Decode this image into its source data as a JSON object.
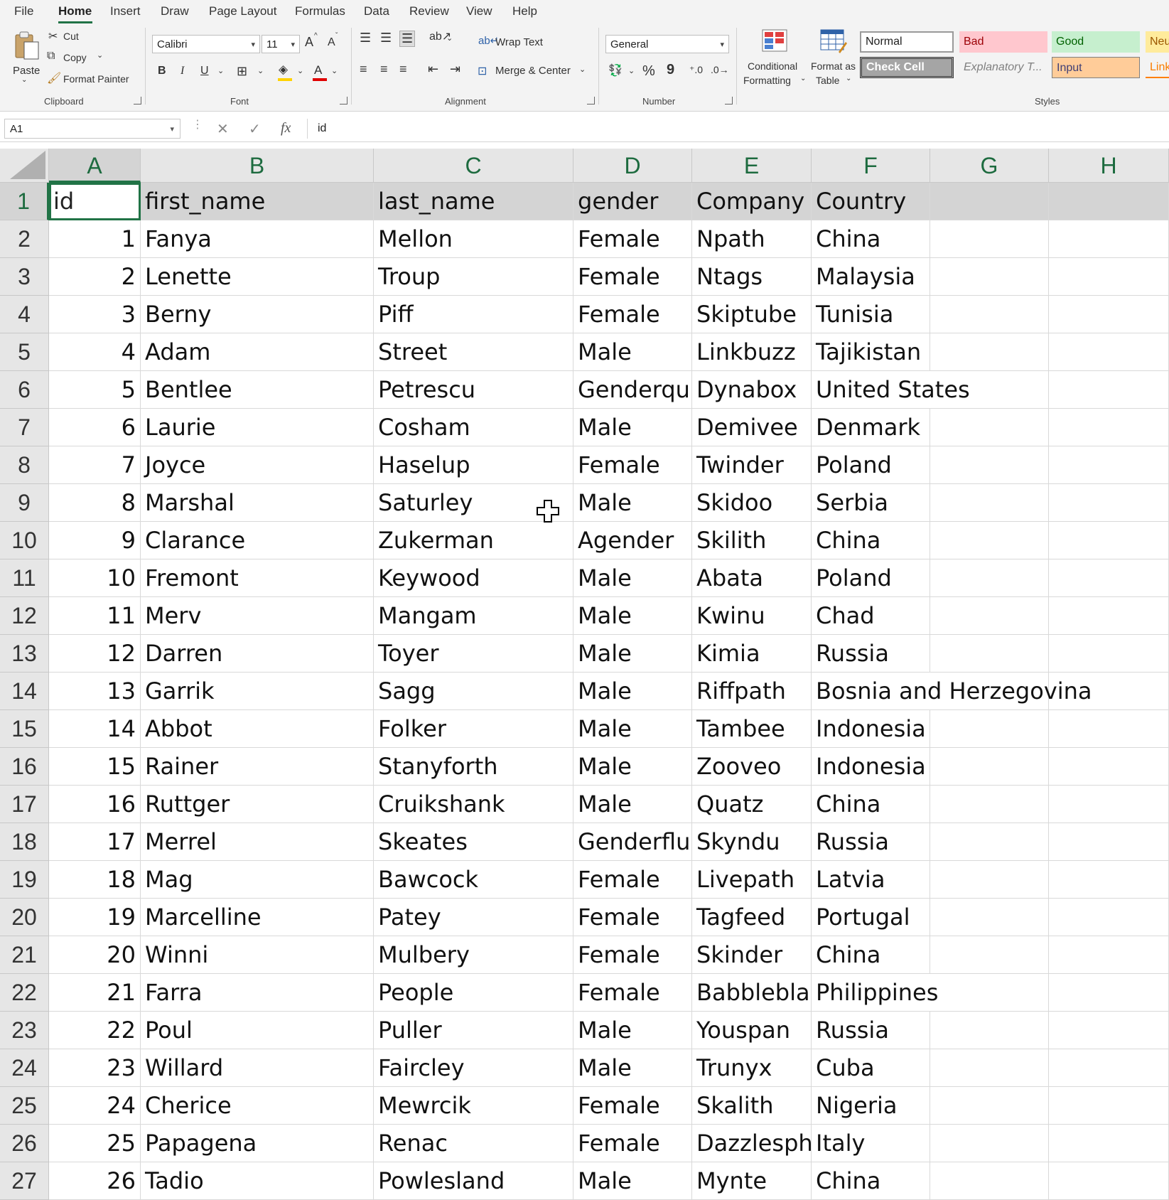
{
  "menu": {
    "tabs": [
      {
        "label": "File"
      },
      {
        "label": "Home",
        "active": true
      },
      {
        "label": "Insert"
      },
      {
        "label": "Draw"
      },
      {
        "label": "Page Layout"
      },
      {
        "label": "Formulas"
      },
      {
        "label": "Data"
      },
      {
        "label": "Review"
      },
      {
        "label": "View"
      },
      {
        "label": "Help"
      }
    ]
  },
  "ribbon": {
    "clipboard": {
      "paste_label": "Paste",
      "cut_label": "Cut",
      "copy_label": "Copy",
      "format_painter_label": "Format Painter",
      "group_label": "Clipboard"
    },
    "font": {
      "font_name": "Calibri",
      "font_size": "11",
      "group_label": "Font",
      "bold": "B",
      "italic": "I",
      "underline": "U",
      "grow": "A",
      "shrink": "A",
      "font_color_glyph": "A"
    },
    "alignment": {
      "wrap_text_label": "Wrap Text",
      "merge_center_label": "Merge & Center",
      "group_label": "Alignment"
    },
    "number": {
      "format": "General",
      "percent": "%",
      "comma": "9",
      "group_label": "Number"
    },
    "styles": {
      "conditional_formatting_line1": "Conditional",
      "conditional_formatting_line2": "Formatting",
      "format_as_table_line1": "Format as",
      "format_as_table_line2": "Table",
      "normal": "Normal",
      "bad": "Bad",
      "good": "Good",
      "neutral": "Neu",
      "check_cell": "Check Cell",
      "explanatory": "Explanatory T...",
      "input": "Input",
      "linked": "Link",
      "group_label": "Styles"
    }
  },
  "formula_bar": {
    "name_box": "A1",
    "fx": "fx",
    "content": "id"
  },
  "grid": {
    "columns": [
      "A",
      "B",
      "C",
      "D",
      "E",
      "F",
      "G",
      "H"
    ],
    "header_row": [
      "id",
      "first_name",
      "last_name",
      "gender",
      "Company",
      "Country"
    ],
    "rows": [
      {
        "n": "2",
        "id": "1",
        "first": "Fanya",
        "last": "Mellon",
        "gender": "Female",
        "company": "Npath",
        "country": "China"
      },
      {
        "n": "3",
        "id": "2",
        "first": "Lenette",
        "last": "Troup",
        "gender": "Female",
        "company": "Ntags",
        "country": "Malaysia"
      },
      {
        "n": "4",
        "id": "3",
        "first": "Berny",
        "last": "Piff",
        "gender": "Female",
        "company": "Skiptube",
        "country": "Tunisia"
      },
      {
        "n": "5",
        "id": "4",
        "first": "Adam",
        "last": "Street",
        "gender": "Male",
        "company": "Linkbuzz",
        "country": "Tajikistan"
      },
      {
        "n": "6",
        "id": "5",
        "first": "Bentlee",
        "last": "Petrescu",
        "gender": "Genderqu",
        "company": "Dynabox",
        "country": "United States"
      },
      {
        "n": "7",
        "id": "6",
        "first": "Laurie",
        "last": "Cosham",
        "gender": "Male",
        "company": "Demivee",
        "country": "Denmark"
      },
      {
        "n": "8",
        "id": "7",
        "first": "Joyce",
        "last": "Haselup",
        "gender": "Female",
        "company": "Twinder",
        "country": "Poland"
      },
      {
        "n": "9",
        "id": "8",
        "first": "Marshal",
        "last": "Saturley",
        "gender": "Male",
        "company": "Skidoo",
        "country": "Serbia"
      },
      {
        "n": "10",
        "id": "9",
        "first": "Clarance",
        "last": "Zukerman",
        "gender": "Agender",
        "company": "Skilith",
        "country": "China"
      },
      {
        "n": "11",
        "id": "10",
        "first": "Fremont",
        "last": "Keywood",
        "gender": "Male",
        "company": "Abata",
        "country": "Poland"
      },
      {
        "n": "12",
        "id": "11",
        "first": "Merv",
        "last": "Mangam",
        "gender": "Male",
        "company": "Kwinu",
        "country": "Chad"
      },
      {
        "n": "13",
        "id": "12",
        "first": "Darren",
        "last": "Toyer",
        "gender": "Male",
        "company": "Kimia",
        "country": "Russia"
      },
      {
        "n": "14",
        "id": "13",
        "first": "Garrik",
        "last": "Sagg",
        "gender": "Male",
        "company": "Riffpath",
        "country": "Bosnia and Herzegovina"
      },
      {
        "n": "15",
        "id": "14",
        "first": "Abbot",
        "last": "Folker",
        "gender": "Male",
        "company": "Tambee",
        "country": "Indonesia"
      },
      {
        "n": "16",
        "id": "15",
        "first": "Rainer",
        "last": "Stanyforth",
        "gender": "Male",
        "company": "Zooveo",
        "country": "Indonesia"
      },
      {
        "n": "17",
        "id": "16",
        "first": "Ruttger",
        "last": "Cruikshank",
        "gender": "Male",
        "company": "Quatz",
        "country": "China"
      },
      {
        "n": "18",
        "id": "17",
        "first": "Merrel",
        "last": "Skeates",
        "gender": "Genderflui",
        "company": "Skyndu",
        "country": "Russia"
      },
      {
        "n": "19",
        "id": "18",
        "first": "Mag",
        "last": "Bawcock",
        "gender": "Female",
        "company": "Livepath",
        "country": "Latvia"
      },
      {
        "n": "20",
        "id": "19",
        "first": "Marcelline",
        "last": "Patey",
        "gender": "Female",
        "company": "Tagfeed",
        "country": "Portugal"
      },
      {
        "n": "21",
        "id": "20",
        "first": "Winni",
        "last": "Mulbery",
        "gender": "Female",
        "company": "Skinder",
        "country": "China"
      },
      {
        "n": "22",
        "id": "21",
        "first": "Farra",
        "last": "People",
        "gender": "Female",
        "company": "Babbleblal",
        "country": "Philippines"
      },
      {
        "n": "23",
        "id": "22",
        "first": "Poul",
        "last": "Puller",
        "gender": "Male",
        "company": "Youspan",
        "country": "Russia"
      },
      {
        "n": "24",
        "id": "23",
        "first": "Willard",
        "last": "Faircley",
        "gender": "Male",
        "company": "Trunyx",
        "country": "Cuba"
      },
      {
        "n": "25",
        "id": "24",
        "first": "Cherice",
        "last": "Mewrcik",
        "gender": "Female",
        "company": "Skalith",
        "country": "Nigeria"
      },
      {
        "n": "26",
        "id": "25",
        "first": "Papagena",
        "last": "Renac",
        "gender": "Female",
        "company": "Dazzlesphe",
        "country": "Italy"
      },
      {
        "n": "27",
        "id": "26",
        "first": "Tadio",
        "last": "Powlesland",
        "gender": "Male",
        "company": "Mynte",
        "country": "China"
      }
    ]
  },
  "colors": {
    "accent": "#217346",
    "bad_bg": "#ffc7ce",
    "bad_fg": "#9c0006",
    "good_bg": "#c6efce",
    "good_fg": "#006100",
    "neutral_bg": "#ffeb9c",
    "input_bg": "#ffcc99",
    "check_bg": "#a5a5a5"
  }
}
